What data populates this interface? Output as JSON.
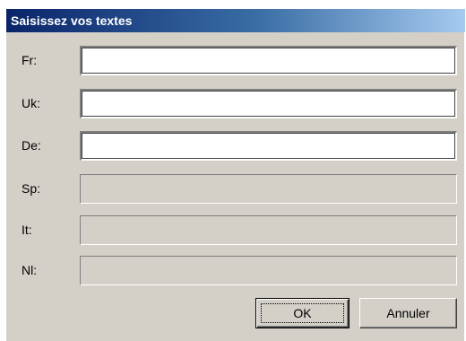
{
  "dialog": {
    "title": "Saisissez vos textes"
  },
  "fields": [
    {
      "label": "Fr:",
      "value": "",
      "enabled": true
    },
    {
      "label": "Uk:",
      "value": "",
      "enabled": true
    },
    {
      "label": "De:",
      "value": "",
      "enabled": true
    },
    {
      "label": "Sp:",
      "value": "",
      "enabled": false
    },
    {
      "label": "It:",
      "value": "",
      "enabled": false
    },
    {
      "label": "Nl:",
      "value": "",
      "enabled": false
    }
  ],
  "buttons": {
    "ok_label": "OK",
    "cancel_label": "Annuler"
  },
  "colors": {
    "dialog_face": "#d4d0c8",
    "title_start": "#0a246a",
    "title_end": "#a6caf0"
  }
}
